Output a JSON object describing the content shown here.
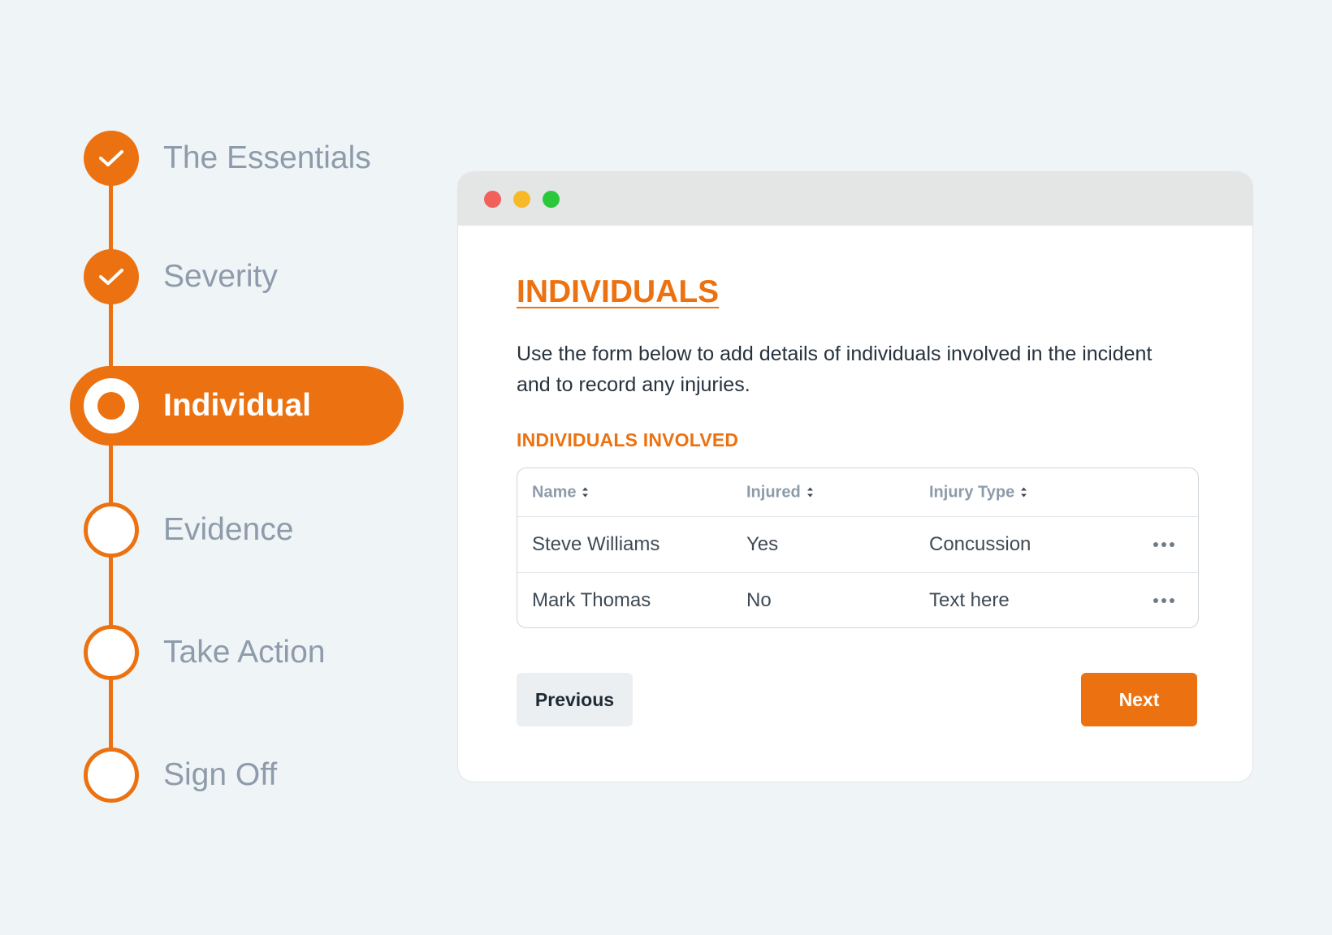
{
  "stepper": {
    "accent_color": "#ec7211",
    "steps": [
      {
        "label": "The Essentials",
        "state": "done"
      },
      {
        "label": "Severity",
        "state": "done"
      },
      {
        "label": "Individual",
        "state": "current"
      },
      {
        "label": "Evidence",
        "state": "todo"
      },
      {
        "label": "Take Action",
        "state": "todo"
      },
      {
        "label": "Sign Off",
        "state": "todo"
      }
    ]
  },
  "window": {
    "title": "INDIVIDUALS",
    "intro": "Use the form below to add details of individuals involved in the incident and to record any injuries.",
    "section_title": "INDIVIDUALS INVOLVED",
    "table": {
      "columns": [
        "Name",
        "Injured",
        "Injury Type"
      ],
      "rows": [
        {
          "name": "Steve Williams",
          "injured": "Yes",
          "injury_type": "Concussion"
        },
        {
          "name": "Mark Thomas",
          "injured": "No",
          "injury_type": "Text here"
        }
      ]
    },
    "buttons": {
      "previous": "Previous",
      "next": "Next"
    }
  }
}
